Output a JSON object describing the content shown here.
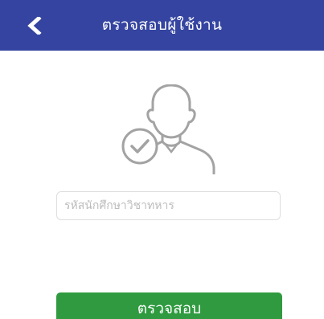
{
  "header": {
    "title": "ตรวจสอบผู้ใช้งาน",
    "back_icon": "chevron-left-icon",
    "background_color": "#3444a0"
  },
  "main": {
    "avatar_icon": "user-verified-icon",
    "id_field": {
      "value": "",
      "placeholder": "รหัสนักศึกษาวิชาทหาร"
    },
    "check_button": {
      "label": "ตรวจสอบ",
      "color": "#2f9a3f"
    }
  }
}
